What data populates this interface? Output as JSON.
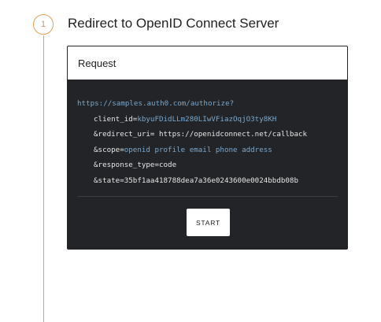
{
  "step": {
    "number": "1",
    "title": "Redirect to OpenID Connect Server"
  },
  "card": {
    "header": "Request",
    "url": "https://samples.auth0.com/authorize?",
    "params": [
      {
        "key": "client_id=",
        "value": "kbyuFDidLLm280LIwVFiazOqjO3ty8KH",
        "value_style": "blue"
      },
      {
        "key": "&redirect_uri=",
        "value": " https://openidconnect.net/callback",
        "value_style": "plain"
      },
      {
        "key": "&scope=",
        "value": "openid profile email phone address",
        "value_style": "blue"
      },
      {
        "key": "&response_type=",
        "value": "code",
        "value_style": "plain"
      },
      {
        "key": "&state=",
        "value": "35bf1aa418788dea7a36e0243600e0024bbdb08b",
        "value_style": "plain"
      }
    ],
    "start_label": "START"
  },
  "colors": {
    "accent": "#e0a458",
    "code_bg": "#222427",
    "code_blue": "#79a8cf"
  }
}
